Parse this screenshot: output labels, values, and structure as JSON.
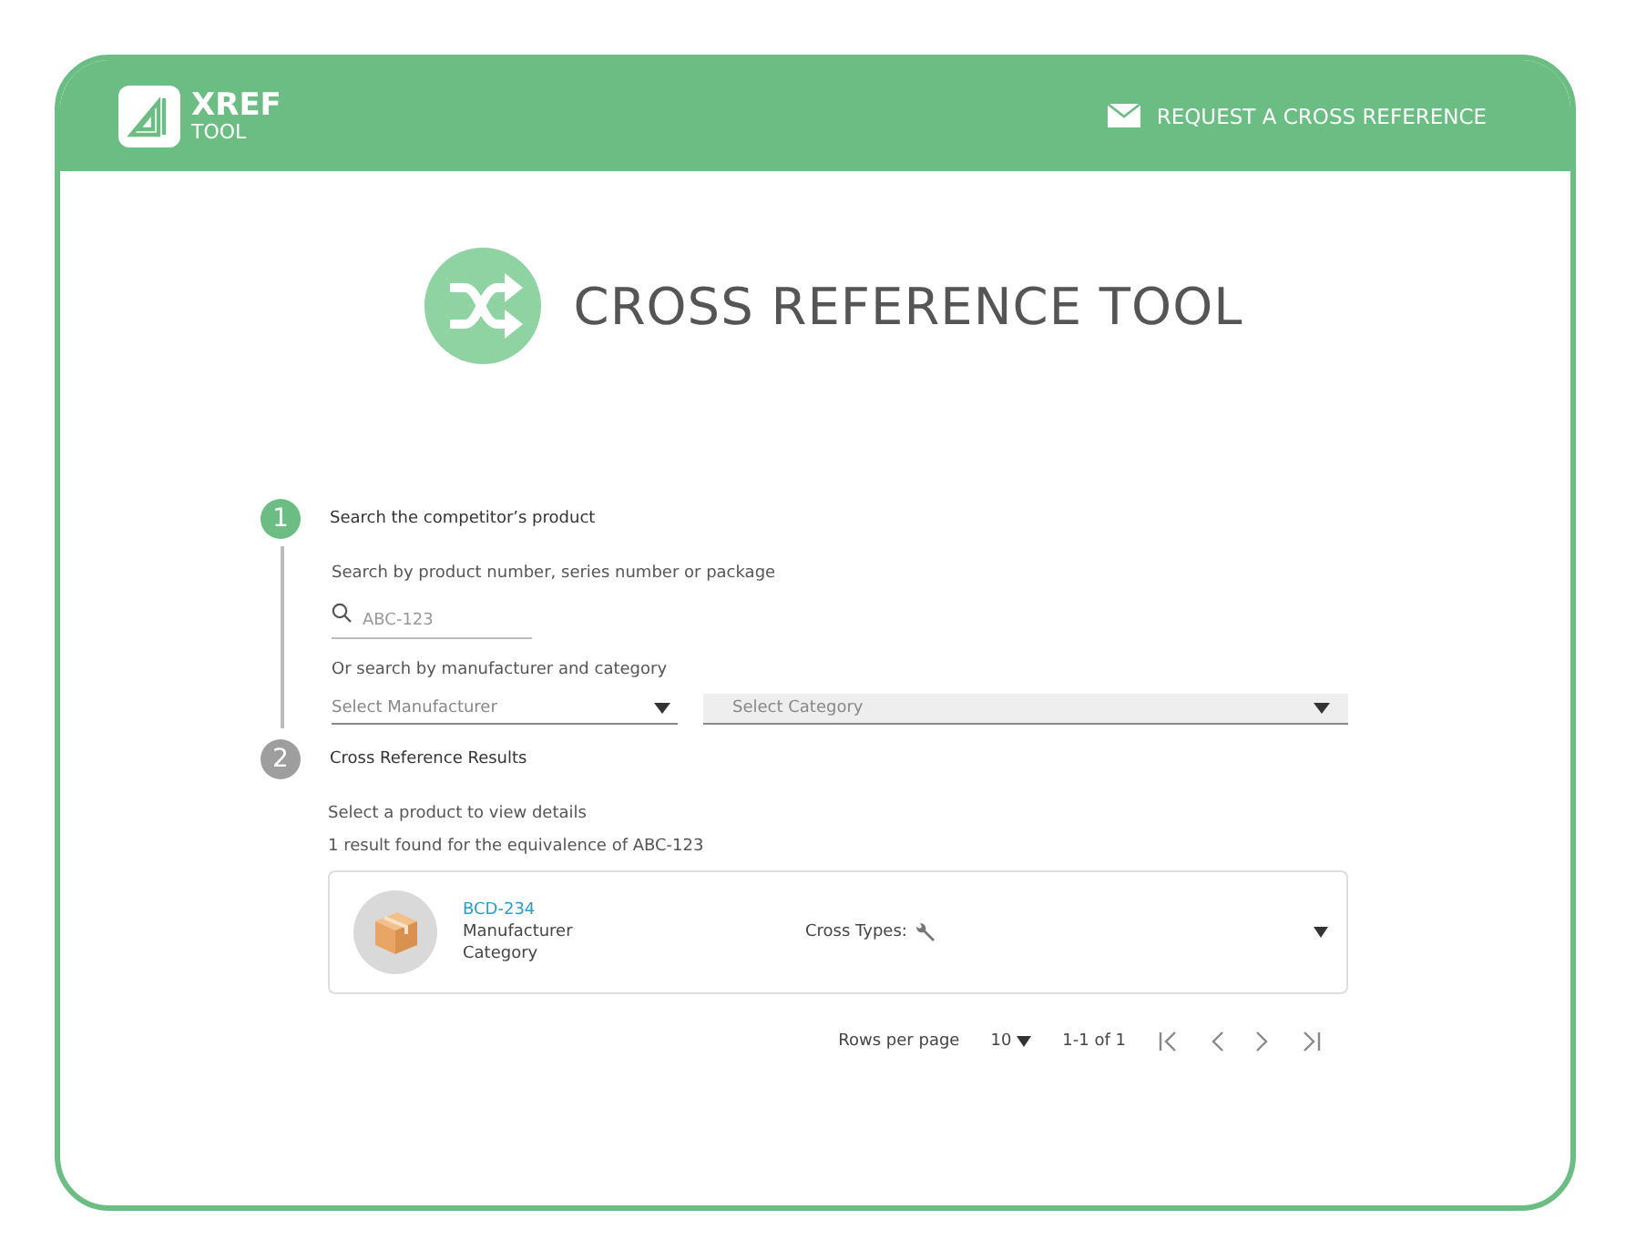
{
  "header": {
    "logo_main": "XREF",
    "logo_sub": "TOOL",
    "request_link": "REQUEST A CROSS REFERENCE"
  },
  "title": "CROSS REFERENCE TOOL",
  "steps": [
    {
      "number": "1",
      "active": true,
      "title": "Search the competitor’s product",
      "search_hint": "Search by product number, series number or package",
      "search": {
        "placeholder": "ABC-123"
      },
      "alt_hint": "Or search by manufacturer and category",
      "selects": [
        {
          "placeholder": "Select Manufacturer",
          "disabled": false
        },
        {
          "placeholder": "Select Category",
          "disabled": true
        }
      ]
    },
    {
      "number": "2",
      "active": false,
      "title": "Cross Reference Results",
      "hint": "Select a product to view details",
      "summary": "1 result found for the equivalence of ABC-123",
      "results": [
        {
          "name": "BCD-234",
          "manufacturer": "Manufacturer",
          "category": "Category",
          "cross_types_label": "Cross Types:"
        }
      ],
      "pagination": {
        "rows_label": "Rows per page",
        "rows_value": "10",
        "range": "1-1 of 1"
      }
    }
  ]
}
